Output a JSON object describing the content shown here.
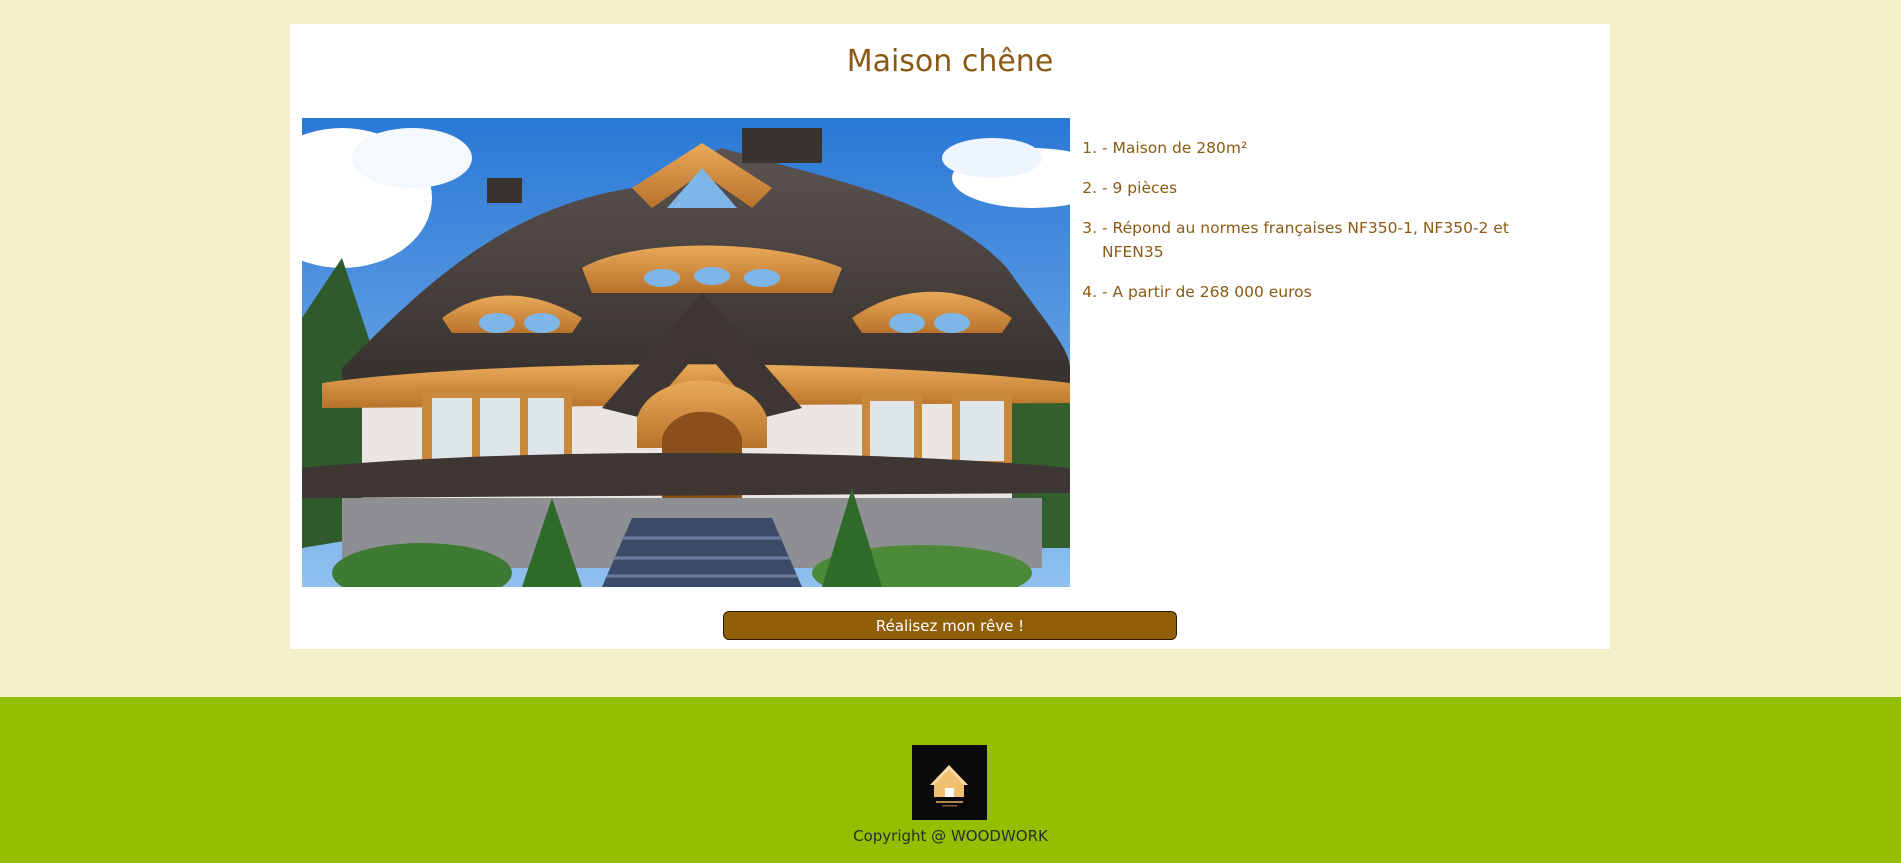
{
  "page": {
    "title": "Maison chêne"
  },
  "features": [
    "- Maison de 280m²",
    "- 9 pièces",
    "- Répond au normes françaises NF350-1, NF350-2 et NFEN35",
    "- A partir de 268 000 euros"
  ],
  "cta": {
    "label": "Réalisez mon rêve !"
  },
  "footer": {
    "copyright": "Copyright @ WOODWORK"
  },
  "colors": {
    "background": "#f5efcc",
    "accent": "#8a5a14",
    "button": "#915f08",
    "footer": "#93bf00"
  },
  "icons": {
    "logo": "house-logo-icon"
  }
}
